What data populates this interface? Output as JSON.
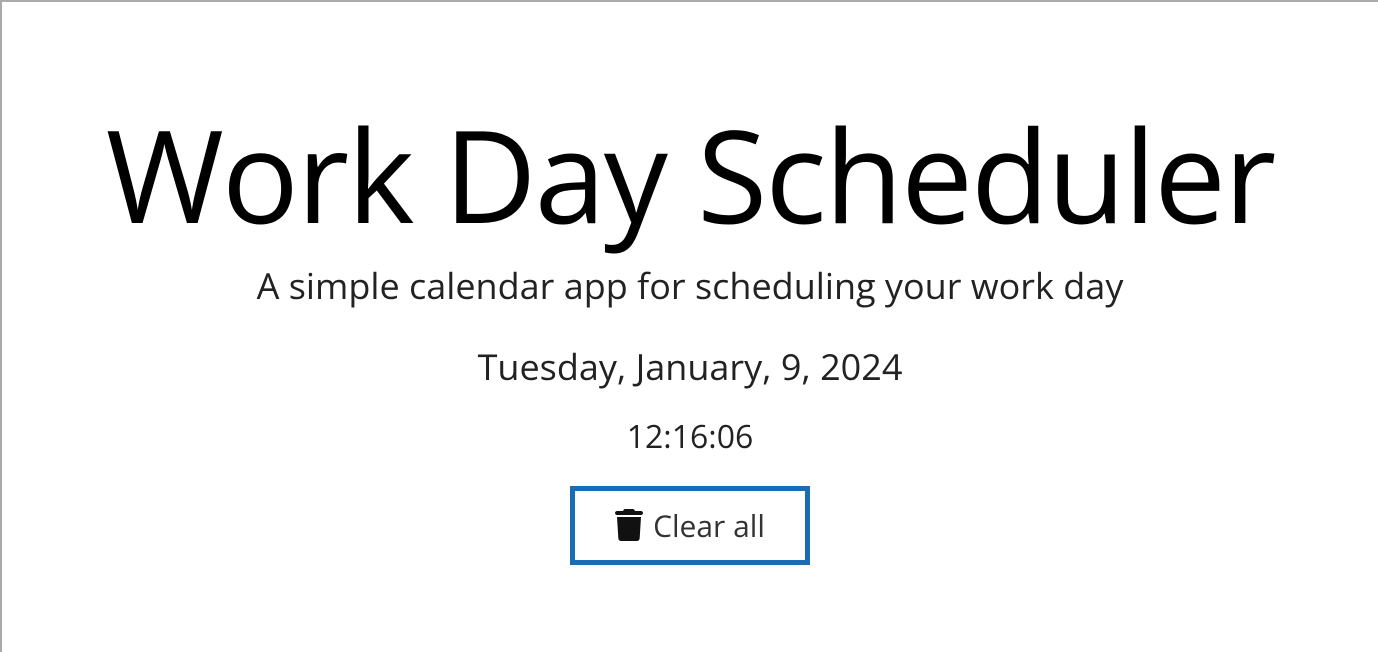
{
  "header": {
    "title": "Work Day Scheduler",
    "subtitle": "A simple calendar app for scheduling your work day",
    "date": "Tuesday, January, 9, 2024",
    "time": "12:16:06",
    "clear_label": "Clear all"
  }
}
